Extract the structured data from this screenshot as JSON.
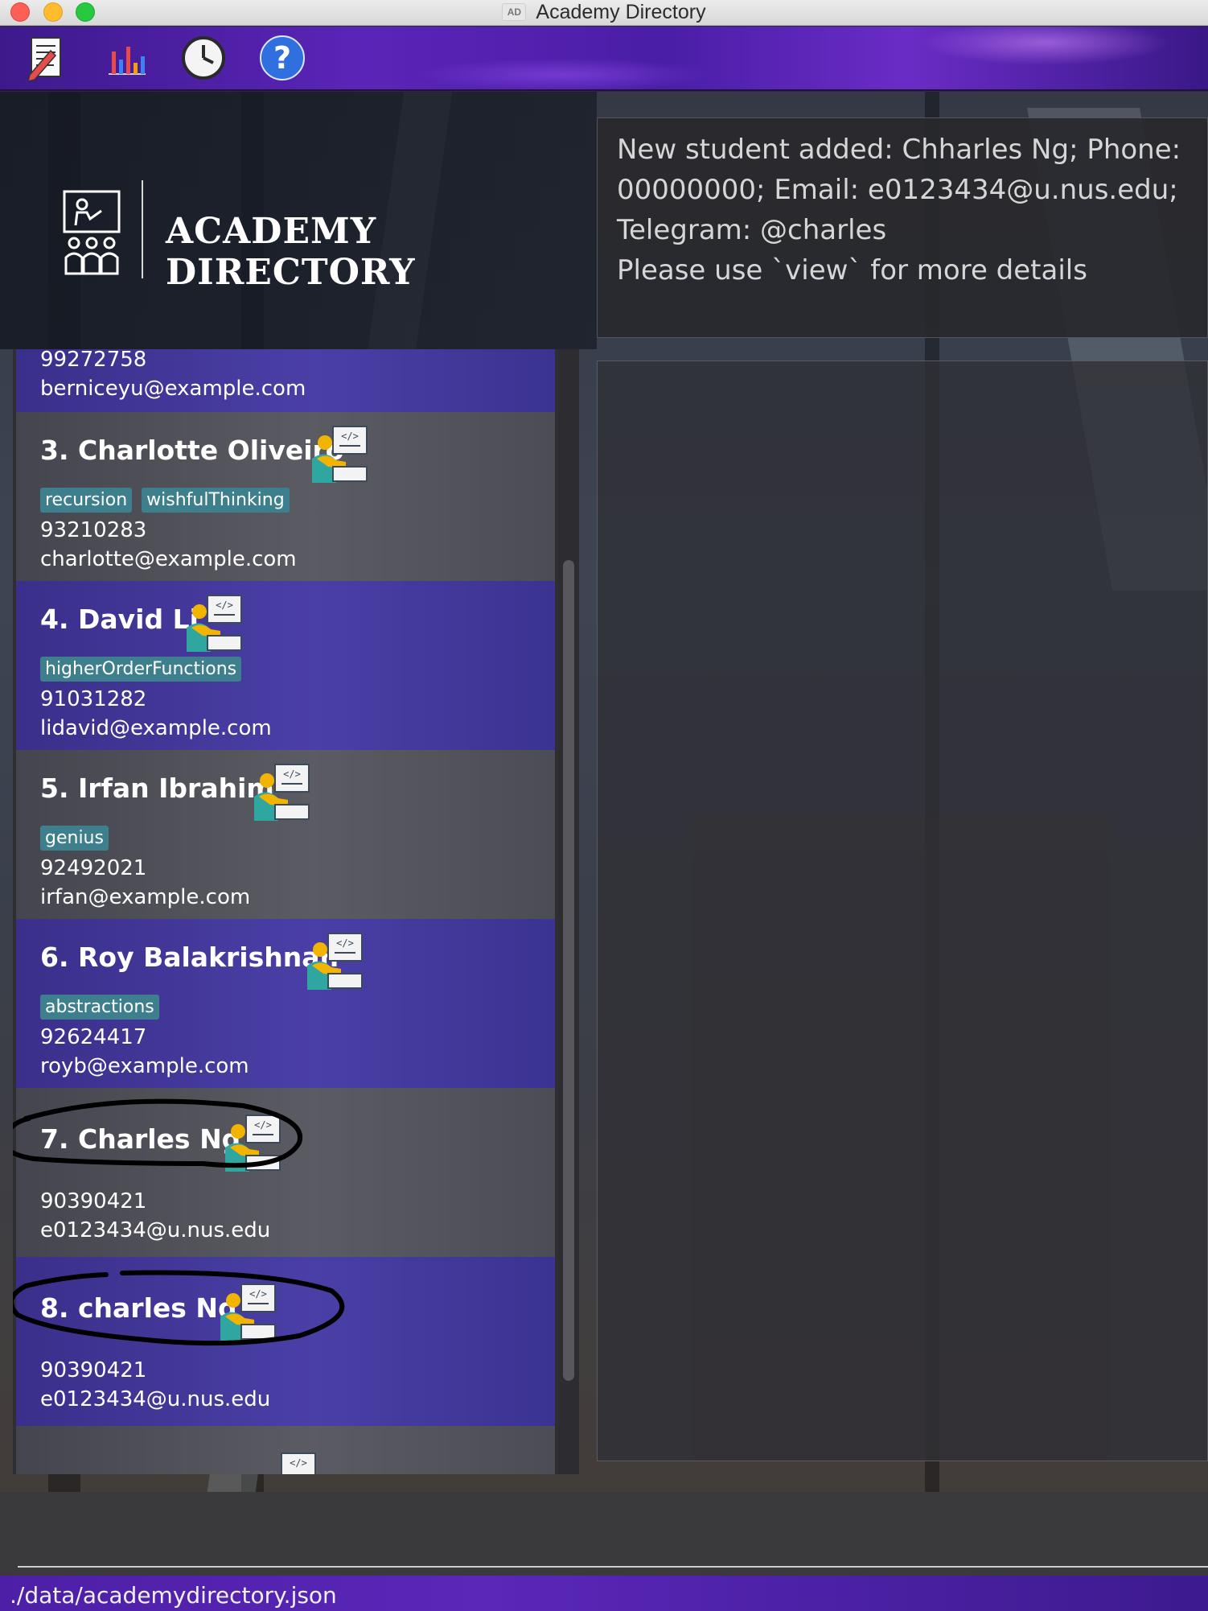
{
  "window": {
    "title": "Academy Directory",
    "badge": "AD"
  },
  "toolbar": {
    "items": [
      {
        "icon": "document-edit-icon"
      },
      {
        "icon": "bar-chart-icon"
      },
      {
        "icon": "clock-icon"
      },
      {
        "icon": "help-icon"
      }
    ]
  },
  "header": {
    "app_name": "ACADEMY DIRECTORY",
    "logo_icon": "teacher-presentation-icon"
  },
  "result": {
    "lines": [
      "New student added: Chharles Ng; Phone:",
      "00000000; Email: e0123434@u.nus.edu;",
      "Telegram: @charles",
      "Please use `view` for more details"
    ]
  },
  "students": [
    {
      "name": "",
      "tags": [],
      "phone": "99272758",
      "email": "berniceyu@example.com",
      "style": "purple",
      "partial": "top"
    },
    {
      "name": "3.  Charlotte Oliveiro",
      "tags": [
        "recursion",
        "wishfulThinking"
      ],
      "phone": "93210283",
      "email": "charlotte@example.com",
      "style": "grey"
    },
    {
      "name": "4.  David Li",
      "tags": [
        "higherOrderFunctions"
      ],
      "phone": "91031282",
      "email": "lidavid@example.com",
      "style": "purple"
    },
    {
      "name": "5.  Irfan Ibrahim",
      "tags": [
        "genius"
      ],
      "phone": "92492021",
      "email": "irfan@example.com",
      "style": "grey"
    },
    {
      "name": "6.  Roy Balakrishnan",
      "tags": [
        "abstractions"
      ],
      "phone": "92624417",
      "email": "royb@example.com",
      "style": "purple"
    },
    {
      "name": "7.  Charles Ng",
      "tags": [],
      "phone": "90390421",
      "email": "e0123434@u.nus.edu",
      "style": "grey",
      "circled": true
    },
    {
      "name": "8.  charles Ng",
      "tags": [],
      "phone": "90390421",
      "email": "e0123434@u.nus.edu",
      "style": "purple",
      "circled": true
    }
  ],
  "command": {
    "value": "",
    "placeholder": ""
  },
  "status": {
    "path": "./data/academydirectory.json"
  },
  "colors": {
    "accent": "#5a27b9",
    "tag": "#3e7f8e",
    "card_purple": "#4a3fa6",
    "card_grey": "#5b5b63"
  }
}
